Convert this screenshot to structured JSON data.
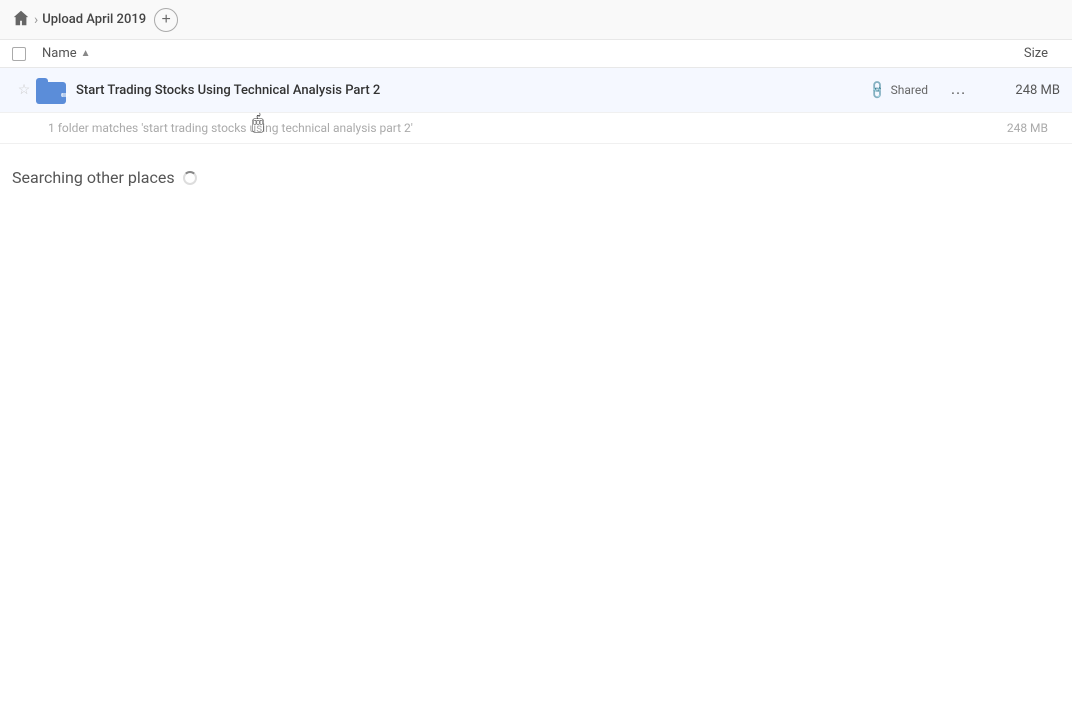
{
  "header": {
    "home_icon": "home-icon",
    "separator": "›",
    "breadcrumb_label": "Upload April 2019",
    "add_button_label": "+"
  },
  "table": {
    "columns": {
      "name": "Name",
      "sort_arrow": "▲",
      "size": "Size"
    }
  },
  "file_row": {
    "name": "Start Trading Stocks Using Technical Analysis Part 2",
    "shared_label": "Shared",
    "size": "248 MB",
    "link_icon": "🔗",
    "more_icon": "…"
  },
  "matches_row": {
    "text": "1 folder matches 'start trading stocks using technical analysis part 2'",
    "size": "248 MB"
  },
  "searching_section": {
    "label": "Searching other places"
  }
}
